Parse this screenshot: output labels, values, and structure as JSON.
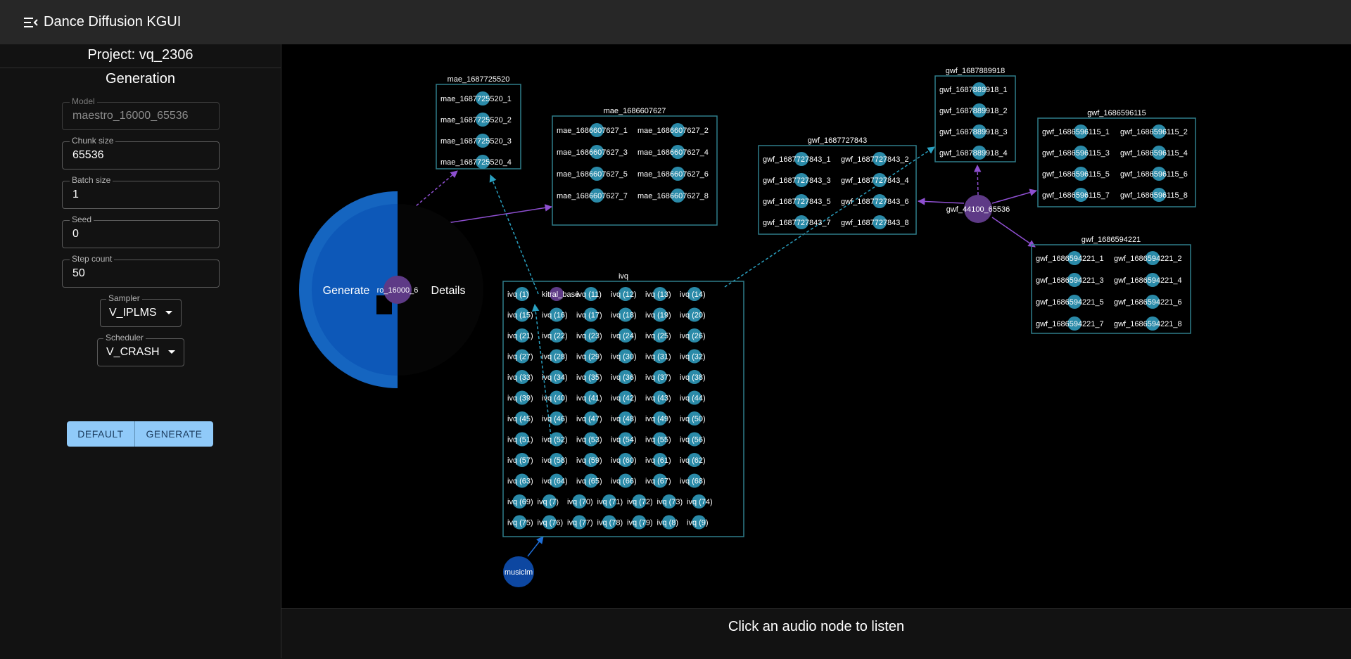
{
  "app": {
    "title": "Dance Diffusion KGUI"
  },
  "sidebar": {
    "project_title": "Project: vq_2306",
    "section_title": "Generation",
    "fields": {
      "model": {
        "label": "Model",
        "value": "maestro_16000_65536"
      },
      "chunk_size": {
        "label": "Chunk size",
        "value": "65536"
      },
      "batch_size": {
        "label": "Batch size",
        "value": "1"
      },
      "seed": {
        "label": "Seed",
        "value": "0"
      },
      "step_count": {
        "label": "Step count",
        "value": "50"
      }
    },
    "sampler": {
      "label": "Sampler",
      "value": "V_IPLMS"
    },
    "scheduler": {
      "label": "Scheduler",
      "value": "V_CRASH"
    },
    "buttons": {
      "default": "DEFAULT",
      "generate": "GENERATE"
    }
  },
  "wheel": {
    "generate_label": "Generate",
    "details_label": "Details",
    "center_label": "ro_16000_6"
  },
  "graph": {
    "groups": [
      {
        "id": "mae_1687725520",
        "title": "mae_1687725520",
        "cols": 1,
        "items": [
          "mae_1687725520_1",
          "mae_1687725520_2",
          "mae_1687725520_3",
          "mae_1687725520_4"
        ]
      },
      {
        "id": "mae_1686607627",
        "title": "mae_1686607627",
        "cols": 2,
        "items": [
          "mae_1686607627_1",
          "mae_1686607627_2",
          "mae_1686607627_3",
          "mae_1686607627_4",
          "mae_1686607627_5",
          "mae_1686607627_6",
          "mae_1686607627_7",
          "mae_1686607627_8"
        ]
      },
      {
        "id": "gwf_1687889918",
        "title": "gwf_1687889918",
        "cols": 1,
        "items": [
          "gwf_1687889918_1",
          "gwf_1687889918_2",
          "gwf_1687889918_3",
          "gwf_1687889918_4"
        ]
      },
      {
        "id": "gwf_1687727843",
        "title": "gwf_1687727843",
        "cols": 2,
        "items": [
          "gwf_1687727843_1",
          "gwf_1687727843_2",
          "gwf_1687727843_3",
          "gwf_1687727843_4",
          "gwf_1687727843_5",
          "gwf_1687727843_6",
          "gwf_1687727843_7",
          "gwf_1687727843_8"
        ]
      },
      {
        "id": "gwf_1686596115",
        "title": "gwf_1686596115",
        "cols": 2,
        "items": [
          "gwf_1686596115_1",
          "gwf_1686596115_2",
          "gwf_1686596115_3",
          "gwf_1686596115_4",
          "gwf_1686596115_5",
          "gwf_1686596115_6",
          "gwf_1686596115_7",
          "gwf_1686596115_8"
        ]
      },
      {
        "id": "gwf_1686594221",
        "title": "gwf_1686594221",
        "cols": 2,
        "items": [
          "gwf_1686594221_1",
          "gwf_1686594221_2",
          "gwf_1686594221_3",
          "gwf_1686594221_4",
          "gwf_1686594221_5",
          "gwf_1686594221_6",
          "gwf_1686594221_7",
          "gwf_1686594221_8"
        ]
      },
      {
        "id": "ivq",
        "title": "ivq",
        "cols": 6,
        "items": [
          "ivq (1)",
          "kitral_base",
          "ivq (11)",
          "ivq (12)",
          "ivq (13)",
          "ivq (14)",
          "ivq (15)",
          "ivq (16)",
          "ivq (17)",
          "ivq (18)",
          "ivq (19)",
          "ivq (20)",
          "ivq (21)",
          "ivq (22)",
          "ivq (23)",
          "ivq (24)",
          "ivq (25)",
          "ivq (26)",
          "ivq (27)",
          "ivq (28)",
          "ivq (29)",
          "ivq (30)",
          "ivq (31)",
          "ivq (32)",
          "ivq (33)",
          "ivq (34)",
          "ivq (35)",
          "ivq (36)",
          "ivq (37)",
          "ivq (38)",
          "ivq (39)",
          "ivq (40)",
          "ivq (41)",
          "ivq (42)",
          "ivq (43)",
          "ivq (44)",
          "ivq (45)",
          "ivq (46)",
          "ivq (47)",
          "ivq (48)",
          "ivq (49)",
          "ivq (50)",
          "ivq (51)",
          "ivq (52)",
          "ivq (53)",
          "ivq (54)",
          "ivq (55)",
          "ivq (56)",
          "ivq (57)",
          "ivq (58)",
          "ivq (59)",
          "ivq (60)",
          "ivq (61)",
          "ivq (62)",
          "ivq (63)",
          "ivq (64)",
          "ivq (65)",
          "ivq (66)",
          "ivq (67)",
          "ivq (68)",
          "ivq (69)",
          "ivq (7)",
          "ivq (70)",
          "ivq (71)",
          "ivq (72)",
          "ivq (73)",
          "ivq (74)",
          "ivq (75)",
          "ivq (76)",
          "ivq (77)",
          "ivq (78)",
          "ivq (79)",
          "ivq (8)",
          "ivq (9)"
        ]
      }
    ],
    "model_nodes": [
      {
        "id": "gwf_44100_65536",
        "label": "gwf_44100_65536"
      },
      {
        "id": "musiclm",
        "label": "musiclm"
      }
    ],
    "colors": {
      "node": "#2a8aa8",
      "node_alt": "#5e3a86",
      "model_node": "#5e3a86",
      "musiclm_node": "#0d47a1",
      "box_border": "#2f7d8a",
      "edge": "#8e4fd0",
      "edge_dashed": "#2aa0c0",
      "wheel_blue": "#1565c0"
    }
  },
  "footer": {
    "status": "Click an audio node to listen"
  }
}
